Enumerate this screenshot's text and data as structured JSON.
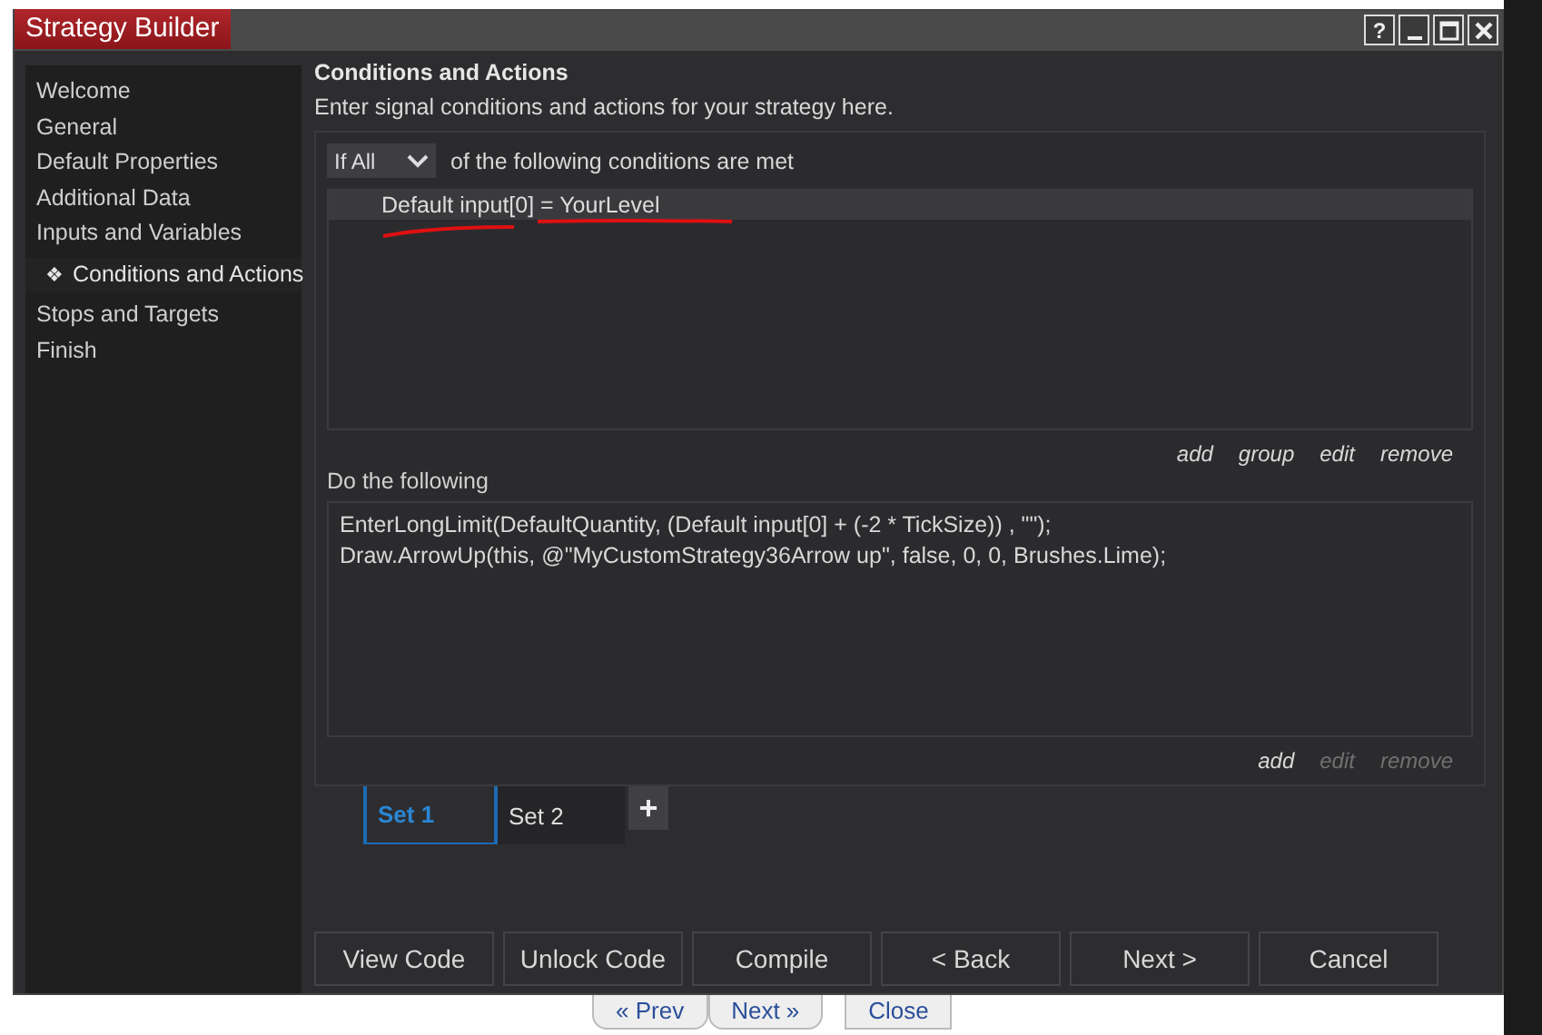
{
  "window": {
    "title": "Strategy Builder",
    "controls": [
      {
        "kind": "help",
        "label": "?"
      },
      {
        "kind": "minimize"
      },
      {
        "kind": "maximize"
      },
      {
        "kind": "close"
      }
    ]
  },
  "sidebar": {
    "items": [
      {
        "label": "Welcome",
        "selected": false
      },
      {
        "label": "General",
        "selected": false
      },
      {
        "label": "Default Properties",
        "selected": false
      },
      {
        "label": "Additional Data",
        "selected": false
      },
      {
        "label": "Inputs and Variables",
        "selected": false
      },
      {
        "label": "Conditions and Actions",
        "selected": true,
        "marker": "❖"
      },
      {
        "label": "Stops and Targets",
        "selected": false
      },
      {
        "label": "Finish",
        "selected": false
      }
    ]
  },
  "header": {
    "title": "Conditions and Actions",
    "subtitle": "Enter signal conditions and actions for your strategy here."
  },
  "conditions": {
    "mode": "If All",
    "suffix": "of the following conditions are met",
    "items": [
      {
        "text": "Default input[0] = YourLevel",
        "annotated": true
      }
    ],
    "actions": [
      {
        "label": "add",
        "disabled": false
      },
      {
        "label": "group",
        "disabled": false
      },
      {
        "label": "edit",
        "disabled": false
      },
      {
        "label": "remove",
        "disabled": false
      }
    ]
  },
  "do_following": {
    "label": "Do the following",
    "lines": [
      "EnterLongLimit(DefaultQuantity, (Default input[0] + (-2 * TickSize)) , \"\");",
      "Draw.ArrowUp(this, @\"MyCustomStrategy36Arrow up\", false, 0, 0, Brushes.Lime);"
    ],
    "actions": [
      {
        "label": "add",
        "disabled": false
      },
      {
        "label": "edit",
        "disabled": true
      },
      {
        "label": "remove",
        "disabled": true
      }
    ]
  },
  "sets": [
    {
      "label": "Set 1",
      "selected": true
    },
    {
      "label": "Set 2",
      "selected": false
    }
  ],
  "add_set": "+",
  "buttons": [
    "View Code",
    "Unlock Code",
    "Compile",
    "< Back",
    "Next >",
    "Cancel"
  ],
  "background_page": {
    "buttons": [
      "« Prev",
      "Next »",
      "Close"
    ]
  }
}
